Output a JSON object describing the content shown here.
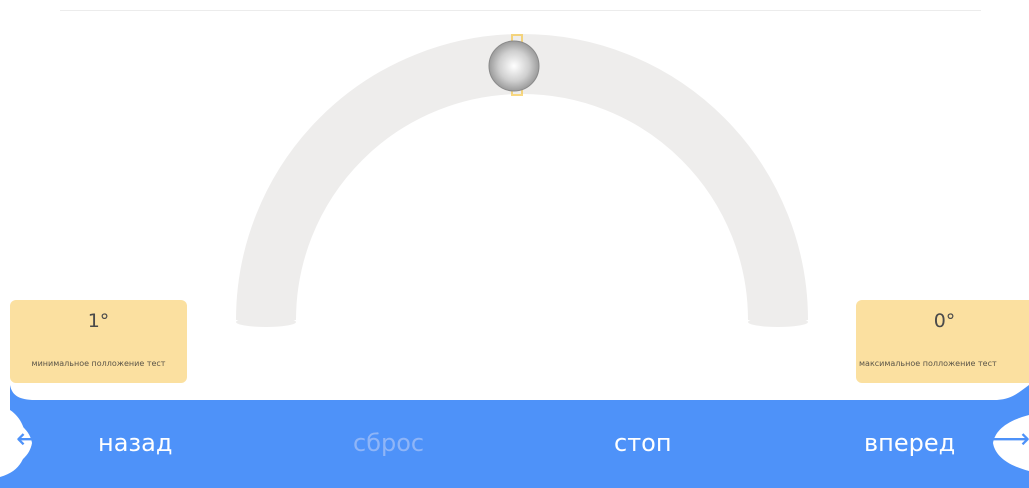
{
  "gauge": {
    "current_value": 0,
    "min_value": 1,
    "max_value": 0,
    "colors": {
      "track": "#eeedec",
      "knob": "#b9b9b9",
      "knob_highlight": "#ffffff",
      "marker": "#f5c84d"
    }
  },
  "min_card": {
    "value": "1°",
    "caption": "минимальное полложение тест"
  },
  "max_card": {
    "value": "0°",
    "caption": "максимальное полложение тест"
  },
  "controls": {
    "back_label": "назад",
    "reset_label": "сброс",
    "stop_label": "стоп",
    "forward_label": "вперед",
    "back_arrow": "⟵",
    "forward_arrow": "⟶"
  },
  "colors": {
    "accent": "#4e92f9",
    "card": "#fbe0a0",
    "disabled_text": "#8fb5f7"
  }
}
